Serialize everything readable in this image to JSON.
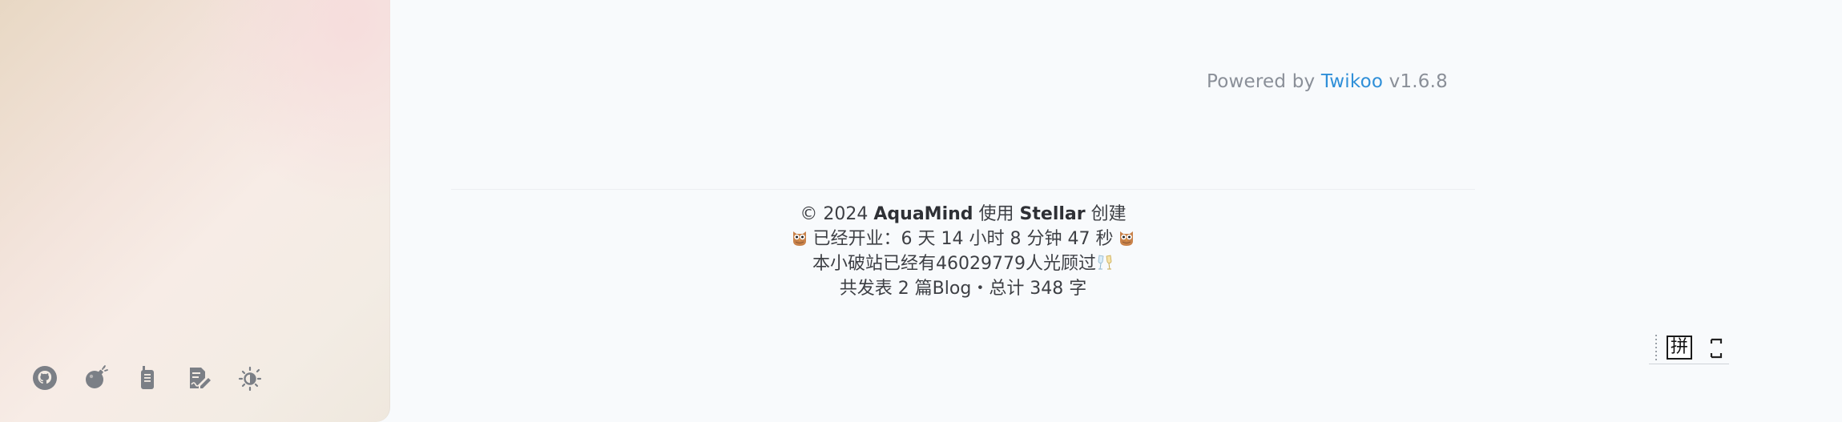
{
  "sidebar": {
    "dock": [
      {
        "name": "github-icon"
      },
      {
        "name": "bomb-icon"
      },
      {
        "name": "walkie-talkie-icon"
      },
      {
        "name": "edit-note-icon"
      },
      {
        "name": "theme-toggle-icon"
      }
    ]
  },
  "comments": {
    "powered_prefix": "Powered by ",
    "powered_link": "Twikoo",
    "powered_version": " v1.6.8"
  },
  "footer": {
    "copyright_prefix": "© 2024 ",
    "author": "AquaMind",
    "made_with": " 使用 ",
    "theme": "Stellar",
    "created": " 创建",
    "uptime": " 已经开业：6 天 14 小时 8 分钟 47 秒 ",
    "visitors": "本小破站已经有46029779人光顾过",
    "stats": "共发表 2 篇Blog・总计 348 字"
  },
  "ime": {
    "mode_label": "拼"
  },
  "colors": {
    "link": "#2f8fd8",
    "text": "#3d3f44",
    "icon": "#7b7f86"
  }
}
